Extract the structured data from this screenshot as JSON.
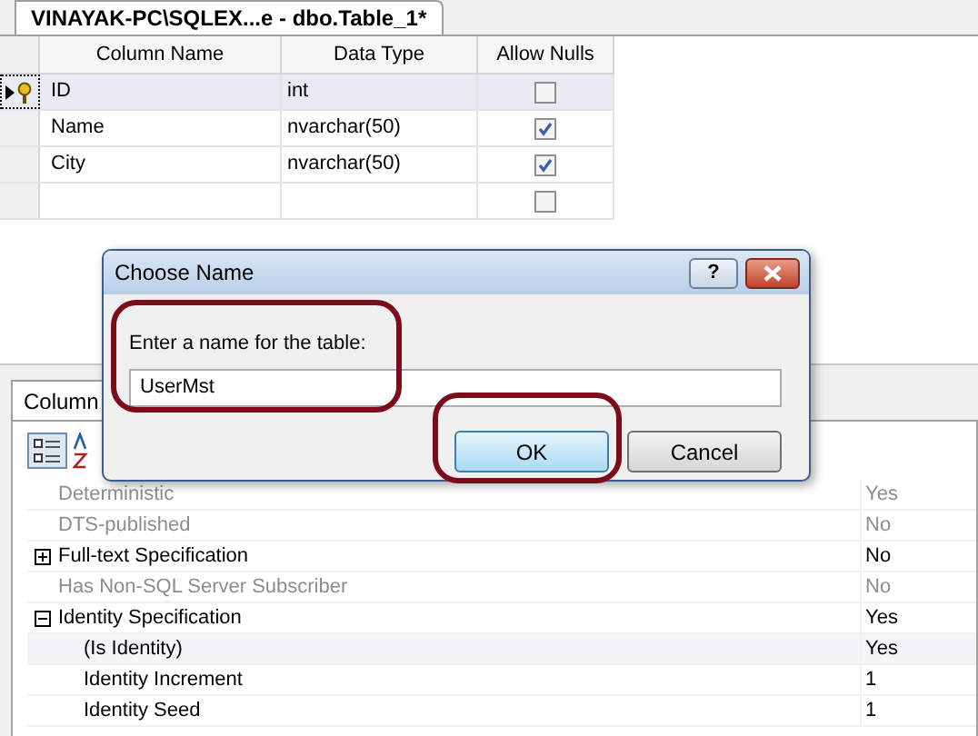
{
  "document_tab": {
    "title": "VINAYAK-PC\\SQLEX...e - dbo.Table_1*"
  },
  "table_designer": {
    "columns": [
      "Column Name",
      "Data Type",
      "Allow Nulls"
    ],
    "rows": [
      {
        "name": "ID",
        "type": "int",
        "allow_nulls": false,
        "selected": true,
        "primary_key": true
      },
      {
        "name": "Name",
        "type": "nvarchar(50)",
        "allow_nulls": true,
        "selected": false,
        "primary_key": false
      },
      {
        "name": "City",
        "type": "nvarchar(50)",
        "allow_nulls": true,
        "selected": false,
        "primary_key": false
      },
      {
        "name": "",
        "type": "",
        "allow_nulls": false,
        "selected": false,
        "primary_key": false
      }
    ]
  },
  "properties_panel": {
    "tab": "Column",
    "properties": [
      {
        "name": "Deterministic",
        "value": "Yes",
        "disabled": true
      },
      {
        "name": "DTS-published",
        "value": "No",
        "disabled": true
      },
      {
        "name": "Full-text Specification",
        "value": "No",
        "disabled": false,
        "expanded": false
      },
      {
        "name": "Has Non-SQL Server Subscriber",
        "value": "No",
        "disabled": true
      },
      {
        "name": "Identity Specification",
        "value": "Yes",
        "disabled": false,
        "expanded": true,
        "children": [
          {
            "name": "(Is Identity)",
            "value": "Yes",
            "disabled": false,
            "selected": true
          },
          {
            "name": "Identity Increment",
            "value": "1",
            "disabled": false,
            "selected": false
          },
          {
            "name": "Identity Seed",
            "value": "1",
            "disabled": false,
            "selected": false
          }
        ]
      }
    ]
  },
  "dialog": {
    "title": "Choose Name",
    "help": "?",
    "prompt": "Enter a name for the table:",
    "value": "UserMst",
    "buttons": [
      {
        "label": "OK",
        "default": true
      },
      {
        "label": "Cancel",
        "default": false
      }
    ]
  }
}
